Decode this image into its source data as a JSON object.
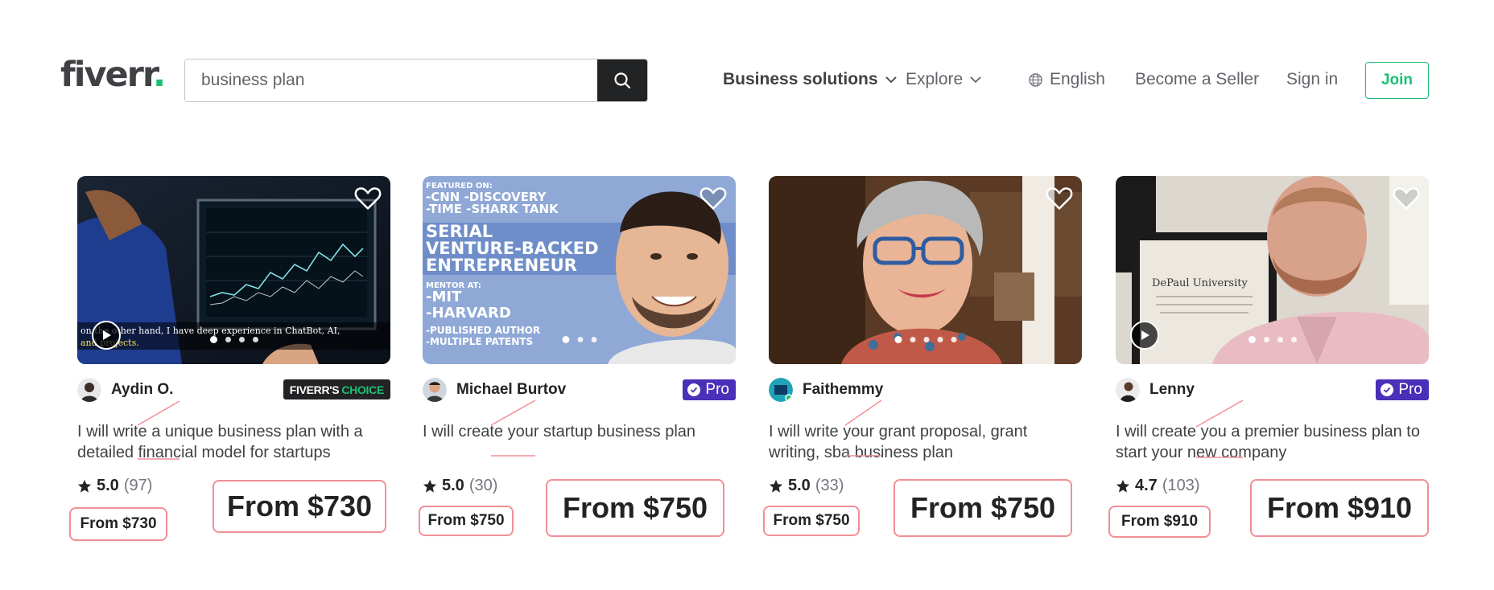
{
  "header": {
    "logo_text": "fiverr",
    "logo_dot": ".",
    "search_value": "business plan",
    "nav": {
      "business_solutions": "Business solutions",
      "explore": "Explore",
      "language": "English",
      "become_seller": "Become a Seller",
      "sign_in": "Sign in",
      "join": "Join"
    }
  },
  "colors": {
    "brand_green": "#1dbf73",
    "pro_purple": "#4a2fb8",
    "highlight_pink": "#f28f95"
  },
  "gigs": [
    {
      "seller": "Aydin O.",
      "badge": {
        "type": "choice",
        "part1": "FIVERR'S",
        "part2": "CHOICE"
      },
      "title": "I will write a unique business plan with a detailed financial model for startups",
      "rating": "5.0",
      "reviews": "(97)",
      "price_small": "From $730",
      "price_big": "From $730",
      "thumb_caption_1": "on the other hand, I have deep experience in ChatBot, AI,",
      "thumb_caption_2": "and projects."
    },
    {
      "seller": "Michael Burtov",
      "badge": {
        "type": "pro",
        "label": "Pro"
      },
      "title": "I will create your startup business plan",
      "rating": "5.0",
      "reviews": "(30)",
      "price_small": "From $750",
      "price_big": "From $750",
      "thumb_lines": [
        "FEATURED ON:",
        "-CNN -DISCOVERY",
        "-TIME -SHARK TANK",
        "SERIAL",
        "VENTURE-BACKED",
        "ENTREPRENEUR",
        "MENTOR AT:",
        "-MIT",
        "-HARVARD",
        "-PUBLISHED AUTHOR",
        "-MULTIPLE PATENTS"
      ]
    },
    {
      "seller": "Faithemmy",
      "badge": null,
      "title": "I will write your grant proposal, grant writing, sba business plan",
      "rating": "5.0",
      "reviews": "(33)",
      "price_small": "From $750",
      "price_big": "From $750"
    },
    {
      "seller": "Lenny",
      "badge": {
        "type": "pro",
        "label": "Pro"
      },
      "title": "I will create you a premier business plan to start your new company",
      "rating": "4.7",
      "reviews": "(103)",
      "price_small": "From $910",
      "price_big": "From $910",
      "thumb_caption_1": "DePaul University"
    }
  ]
}
